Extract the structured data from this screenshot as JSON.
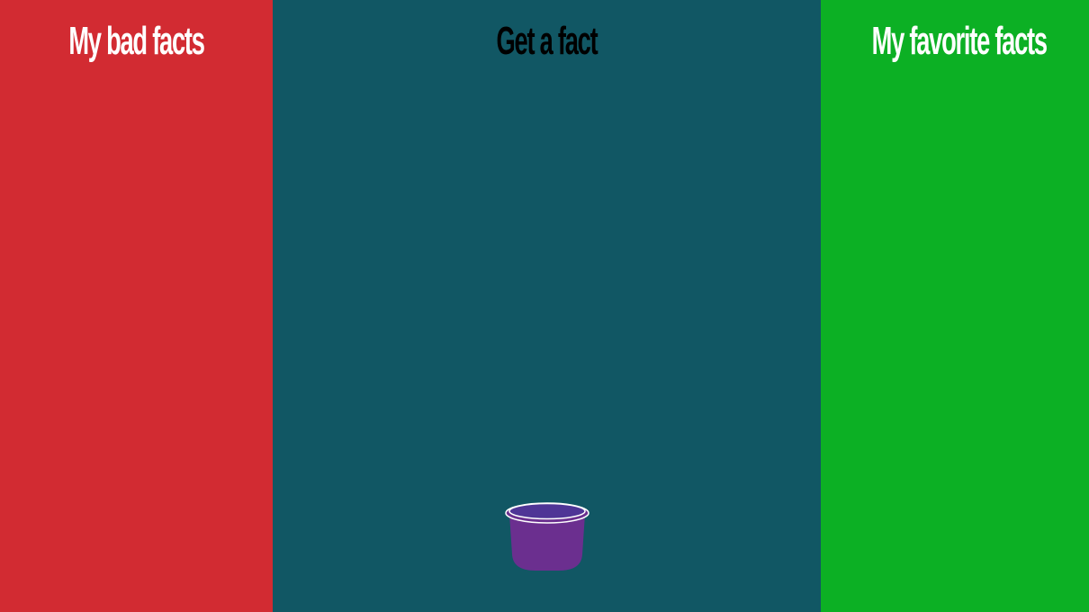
{
  "columns": {
    "bad": {
      "title": "My bad facts",
      "color": "#d22b32",
      "title_color": "#ffffff"
    },
    "get": {
      "title": "Get a fact",
      "color": "#115764",
      "title_color": "#000000"
    },
    "favorite": {
      "title": "My favorite facts",
      "color": "#0cb024",
      "title_color": "#ffffff"
    }
  },
  "bucket": {
    "icon": "bucket-icon",
    "color": "#6b2f8f",
    "inner_color": "#4f3596",
    "rim_color": "#ffffff"
  }
}
